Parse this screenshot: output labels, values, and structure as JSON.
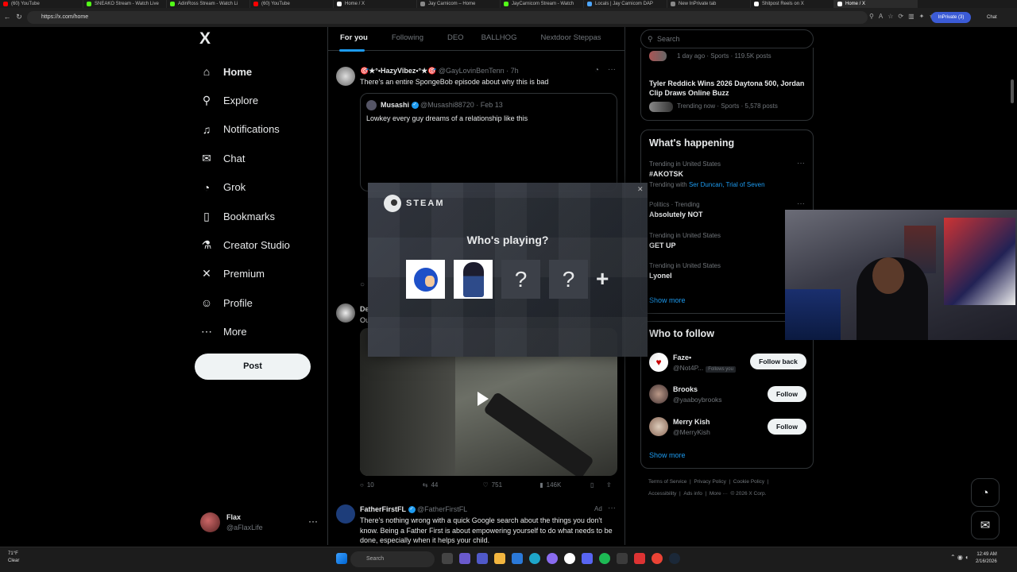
{
  "browser": {
    "tabs": [
      {
        "label": "(60) YouTube",
        "color": "#ff0000"
      },
      {
        "label": "SNEAKO Stream - Watch Live",
        "color": "#53fc18"
      },
      {
        "label": "AdinRoss Stream - Watch Li",
        "color": "#53fc18"
      },
      {
        "label": "(60) YouTube",
        "color": "#ff0000"
      },
      {
        "label": "Home / X",
        "color": "#ffffff"
      },
      {
        "label": "Jay Carnicom – Home",
        "color": "#888888"
      },
      {
        "label": "JayCarnicom Stream - Watch",
        "color": "#53fc18"
      },
      {
        "label": "Locals | Jay Carnicom DAP",
        "color": "#4da6ff"
      },
      {
        "label": "New InPrivate tab",
        "color": "#888888"
      },
      {
        "label": "Shitpost Reels on X",
        "color": "#ffffff"
      },
      {
        "label": "Home / X",
        "color": "#ffffff"
      }
    ],
    "url": "https://x.com/home",
    "inprivate_label": "InPrivate (3)",
    "chat_label": "Chat"
  },
  "sidebar": {
    "logo": "X",
    "items": [
      {
        "label": "Home",
        "icon": "home-icon",
        "glyph": "⌂"
      },
      {
        "label": "Explore",
        "icon": "search-icon",
        "glyph": "⚲"
      },
      {
        "label": "Notifications",
        "icon": "bell-icon",
        "glyph": "🔔"
      },
      {
        "label": "Chat",
        "icon": "mail-icon",
        "glyph": "✉"
      },
      {
        "label": "Grok",
        "icon": "grok-icon",
        "glyph": "◔"
      },
      {
        "label": "Bookmarks",
        "icon": "bookmark-icon",
        "glyph": "🔖"
      },
      {
        "label": "Creator Studio",
        "icon": "flask-icon",
        "glyph": "⚗"
      },
      {
        "label": "Premium",
        "icon": "x-premium-icon",
        "glyph": "✕"
      },
      {
        "label": "Profile",
        "icon": "person-icon",
        "glyph": "☺"
      },
      {
        "label": "More",
        "icon": "more-circle-icon",
        "glyph": "⋯"
      }
    ],
    "post_label": "Post",
    "account": {
      "name": "Flax",
      "handle": "@aFlaxLife",
      "more": "···"
    }
  },
  "main": {
    "tabs": [
      "For you",
      "Following",
      "DEO",
      "BALLHOG",
      "Nextdoor Steppas"
    ],
    "tweets": [
      {
        "name": "🎯★°•HazyVibez•°★🎯",
        "handle": "@GayLovinBenTenn · 7h",
        "text": "There's an entire SpongeBob episode about why this is bad",
        "quote": {
          "name": "Musashi",
          "handle": "@Musashi88720 · Feb 13",
          "text": "Lowkey every guy dreams of a relationship like this"
        }
      },
      {
        "name": "De",
        "text": "Ou",
        "actions": {
          "replies": "10",
          "reposts": "44",
          "likes": "751",
          "views": "146K"
        }
      },
      {
        "name": "FatherFirstFL",
        "handle": "@FatherFirstFL",
        "ad": "Ad",
        "text": "There's nothing wrong with a quick Google search about the things you don't know. Being a Father First is about empowering yourself to do what needs to be done, especially when it helps your child."
      }
    ]
  },
  "right": {
    "search_placeholder": "Search",
    "top_card": {
      "first_meta": "1 day ago · Sports · 119.5K posts",
      "story_title": "Tyler Reddick Wins 2026 Daytona 500, Jordan Clip Draws Online Buzz",
      "story_meta": "Trending now · Sports · 5,578 posts"
    },
    "happening": {
      "title": "What's happening",
      "items": [
        {
          "context": "Trending in United States",
          "topic": "#AKOTSK",
          "extra_prefix": "Trending with ",
          "extra_links": "Ser Duncan, Trial of Seven"
        },
        {
          "context": "Politics · Trending",
          "topic": "Absolutely NOT"
        },
        {
          "context": "Trending in United States",
          "topic": "GET UP"
        },
        {
          "context": "Trending in United States",
          "topic": "Lyonel"
        }
      ],
      "show_more": "Show more"
    },
    "follow": {
      "title": "Who to follow",
      "items": [
        {
          "name": "Faze•",
          "handle": "@Not4P...",
          "follows_you": "Follows you",
          "button": "Follow back"
        },
        {
          "name": "Brooks",
          "handle": "@yaaboybrooks",
          "button": "Follow"
        },
        {
          "name": "Merry Kish",
          "handle": "@MerryKish",
          "button": "Follow"
        }
      ],
      "show_more": "Show more"
    },
    "footer_line1": [
      "Terms of Service",
      "|",
      "Privacy Policy",
      "|",
      "Cookie Policy",
      "|"
    ],
    "footer_line2": [
      "Accessibility",
      "|",
      "Ads info",
      "|",
      "More ···",
      "© 2026 X Corp."
    ]
  },
  "steam_overlay": {
    "brand": "STEAM",
    "prompt": "Who's playing?",
    "slot_q1": "?",
    "slot_q2": "?",
    "add": "+",
    "close": "✕"
  },
  "taskbar": {
    "weather_temp": "71°F",
    "weather_desc": "Clear",
    "search_placeholder": "Search",
    "time": "12:49 AM",
    "date": "2/16/2026"
  },
  "colors": {
    "accent": "#1d9bf0",
    "background": "#000000",
    "border": "#2f3336"
  }
}
